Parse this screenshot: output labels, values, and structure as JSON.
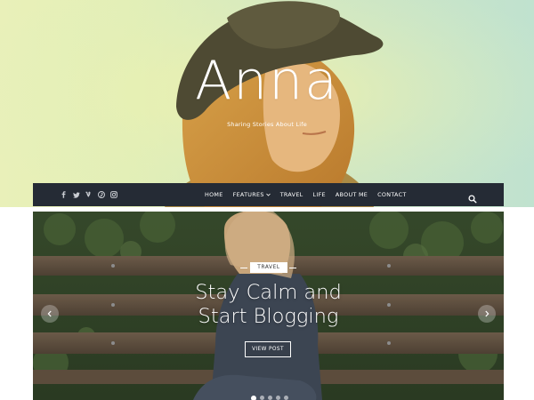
{
  "site": {
    "title": "Anna",
    "tagline": "Sharing Stories About Life"
  },
  "nav": {
    "social_icons": [
      "facebook-icon",
      "twitter-icon",
      "vine-icon",
      "pinterest-icon",
      "instagram-icon"
    ],
    "items": [
      {
        "label": "HOME"
      },
      {
        "label": "FEATURES",
        "has_dropdown": true
      },
      {
        "label": "TRAVEL"
      },
      {
        "label": "LIFE"
      },
      {
        "label": "ABOUT ME"
      },
      {
        "label": "CONTACT"
      }
    ],
    "search_icon": "search-icon"
  },
  "slider": {
    "category": "TRAVEL",
    "title_line1": "Stay Calm and",
    "title_line2": "Start Blogging",
    "button_label": "VIEW POST",
    "slide_count": 5,
    "active_slide": 1
  },
  "colors": {
    "nav_bg": "#252b35",
    "hero_tint": "#e3efb6",
    "text_light": "#ffffff"
  }
}
